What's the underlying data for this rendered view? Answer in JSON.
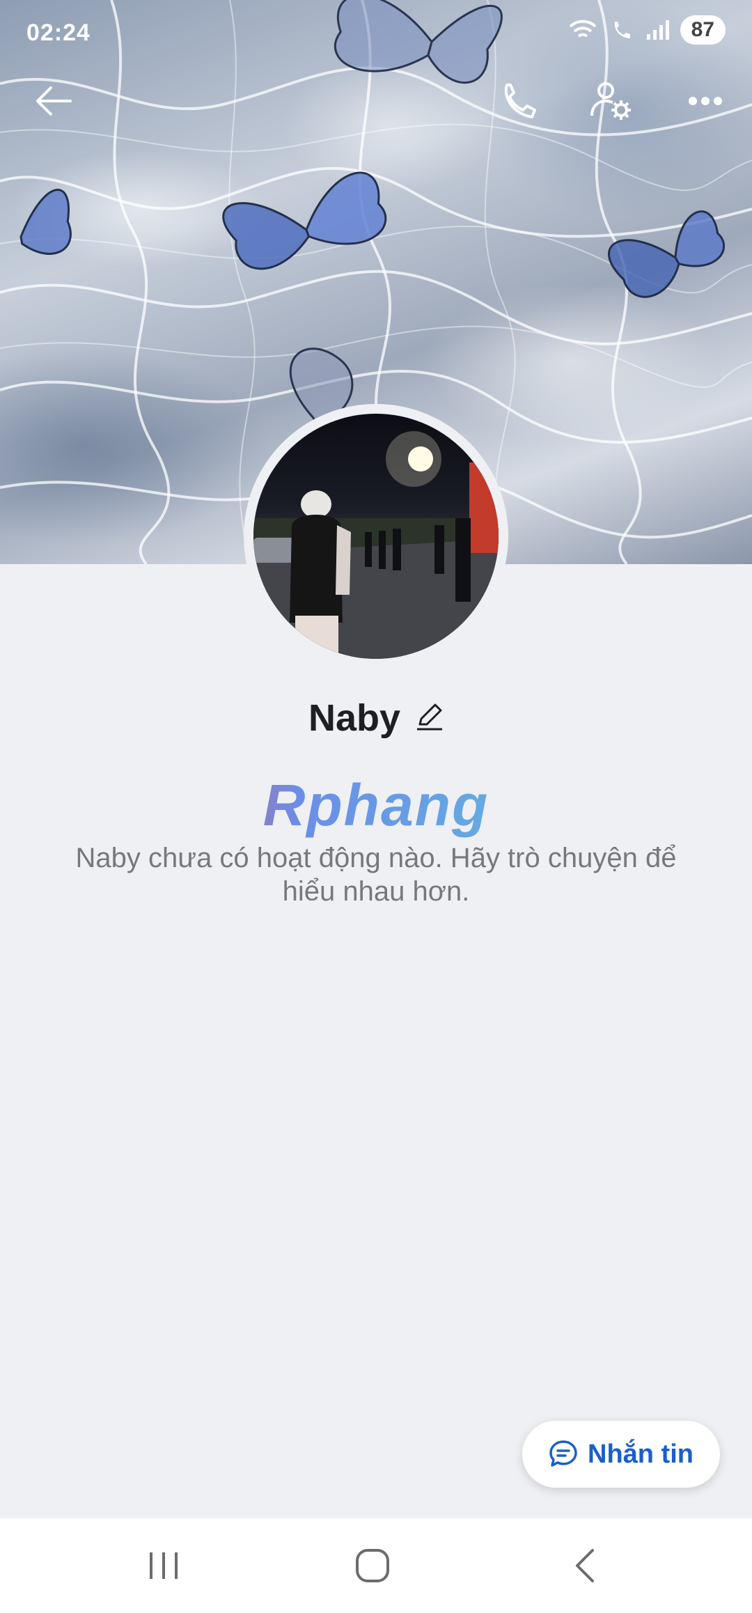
{
  "status": {
    "time": "02:24",
    "battery": "87"
  },
  "header": {
    "back_icon": "arrow-left-icon",
    "call_icon": "phone-icon",
    "settings_icon": "user-settings-icon",
    "more_icon": "more-horizontal-icon"
  },
  "profile": {
    "name": "Naby",
    "edit_icon": "pencil-icon",
    "watermark": "Rphang",
    "empty_message": "Naby chưa có hoạt động nào. Hãy trò chuyện để hiểu nhau hơn."
  },
  "actions": {
    "message_label": "Nhắn tin",
    "message_icon": "chat-bubble-icon"
  },
  "colors": {
    "accent": "#1a5fc8",
    "background": "#eff0f4",
    "text_secondary": "#77787d"
  },
  "system_nav": {
    "recents_icon": "recents-icon",
    "home_icon": "home-icon",
    "back_icon": "back-chevron-icon"
  }
}
